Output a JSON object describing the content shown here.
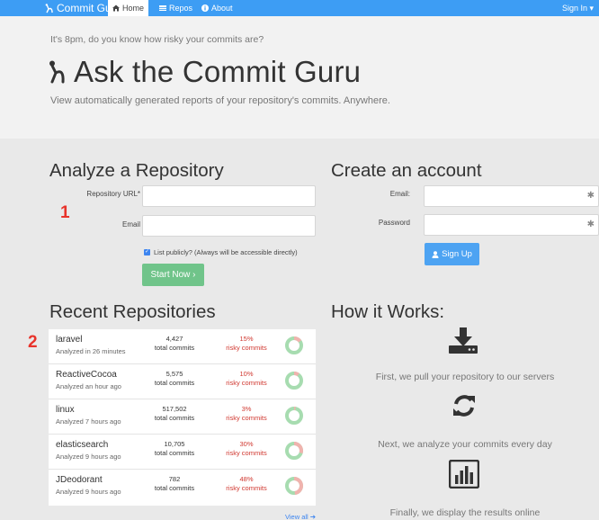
{
  "navbar": {
    "brand": "Commit Guru",
    "items": [
      {
        "label": "Home",
        "icon": "home-icon",
        "active": true
      },
      {
        "label": "Repos",
        "icon": "list-icon",
        "active": false
      },
      {
        "label": "About",
        "icon": "info-icon",
        "active": false
      }
    ],
    "signin": "Sign In ▾"
  },
  "jumbo": {
    "tagline": "It's 8pm, do you know how risky your commits are?",
    "title": "Ask the Commit Guru",
    "subtitle": "View automatically generated reports of your repository's commits. Anywhere."
  },
  "analyze": {
    "heading": "Analyze a Repository",
    "repo_url_label": "Repository URL*",
    "repo_url_value": "",
    "email_label": "Email",
    "email_value": "",
    "checkbox_label": "List publicly? (Always will be accessible directly)",
    "checkbox_checked": true,
    "button": "Start Now ›"
  },
  "account": {
    "heading": "Create an account",
    "email_label": "Email:",
    "email_value": "",
    "password_label": "Password",
    "password_value": "",
    "required_mark": "✱",
    "button": "Sign Up"
  },
  "annotations": [
    "1",
    "2"
  ],
  "recent": {
    "heading": "Recent Repositories",
    "rows": [
      {
        "name": "laravel",
        "time": "Analyzed in 26 minutes",
        "commits": "4,427",
        "commits_label": "total commits",
        "risk": "15%",
        "risk_label": "risky commits",
        "risk_fraction": 0.15
      },
      {
        "name": "ReactiveCocoa",
        "time": "Analyzed an hour ago",
        "commits": "5,575",
        "commits_label": "total commits",
        "risk": "10%",
        "risk_label": "risky commits",
        "risk_fraction": 0.1
      },
      {
        "name": "linux",
        "time": "Analyzed 7 hours ago",
        "commits": "517,502",
        "commits_label": "total commits",
        "risk": "3%",
        "risk_label": "risky commits",
        "risk_fraction": 0.03
      },
      {
        "name": "elasticsearch",
        "time": "Analyzed 9 hours ago",
        "commits": "10,705",
        "commits_label": "total commits",
        "risk": "30%",
        "risk_label": "risky commits",
        "risk_fraction": 0.3
      },
      {
        "name": "JDeodorant",
        "time": "Analyzed 9 hours ago",
        "commits": "782",
        "commits_label": "total commits",
        "risk": "48%",
        "risk_label": "risky commits",
        "risk_fraction": 0.48
      }
    ],
    "view_all": "View all ➔"
  },
  "how": {
    "heading": "How it Works:",
    "steps": [
      {
        "icon": "download-icon",
        "text": "First, we pull your repository to our servers"
      },
      {
        "icon": "refresh-icon",
        "text": "Next, we analyze your commits every day"
      },
      {
        "icon": "bar-chart-icon",
        "text": "Finally, we display the results online"
      }
    ]
  },
  "colors": {
    "navbar": "#3d9df4",
    "start_button": "#70c48a",
    "signup_button": "#4da3f2",
    "risk_text": "#d0372f",
    "donut_safe": "#a7dcb0",
    "donut_risky": "#f0b3ae",
    "annotation": "#e8332b"
  }
}
